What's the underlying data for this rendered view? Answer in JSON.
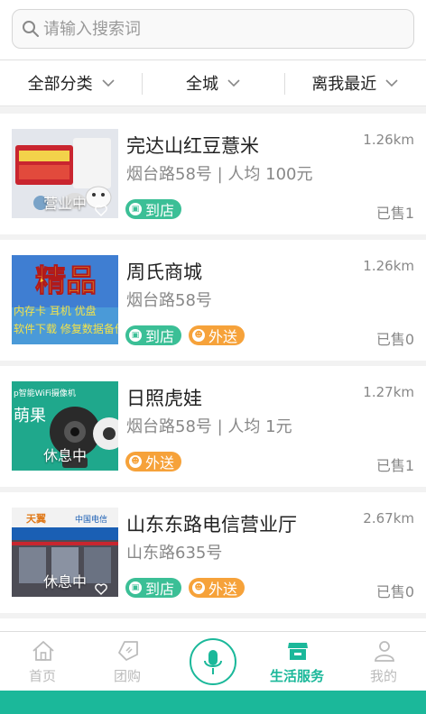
{
  "search": {
    "placeholder": "请输入搜索词"
  },
  "filters": [
    {
      "label": "全部分类"
    },
    {
      "label": "全城"
    },
    {
      "label": "离我最近"
    }
  ],
  "shops": [
    {
      "name": "完达山红豆薏米",
      "distance": "1.26km",
      "address": "烟台路58号 | 人均 100元",
      "status": "营业中",
      "sold": "已售1",
      "tags": [
        "到店"
      ]
    },
    {
      "name": "周氏商城",
      "distance": "1.26km",
      "address": "烟台路58号",
      "status": "",
      "sold": "已售0",
      "tags": [
        "到店",
        "外送"
      ]
    },
    {
      "name": "日照虎娃",
      "distance": "1.27km",
      "address": "烟台路58号 | 人均 1元",
      "status": "休息中",
      "sold": "已售1",
      "tags": [
        "外送"
      ]
    },
    {
      "name": "山东东路电信营业厅",
      "distance": "2.67km",
      "address": "山东路635号",
      "status": "休息中",
      "sold": "已售0",
      "tags": [
        "到店",
        "外送"
      ]
    }
  ],
  "thumb_text": {
    "shop2_line1": "精品",
    "shop2_line2": "内存卡 耳机 优盘",
    "shop2_line3": "软件下载 修复数据备份",
    "shop3_line1": "p智能WiFi摄像机",
    "shop3_line2": "萌果",
    "shop4_brand": "天翼",
    "shop4_brand2": "中国电信"
  },
  "tabs": [
    {
      "label": "首页",
      "icon": "home-icon"
    },
    {
      "label": "团购",
      "icon": "coupon-icon"
    },
    {
      "label": "",
      "icon": "microphone-icon"
    },
    {
      "label": "生活服务",
      "icon": "store-icon"
    },
    {
      "label": "我的",
      "icon": "user-icon"
    }
  ],
  "colors": {
    "accent": "#1bb89a",
    "tag_store": "#3bbf96",
    "tag_delivery": "#f6a23a"
  }
}
